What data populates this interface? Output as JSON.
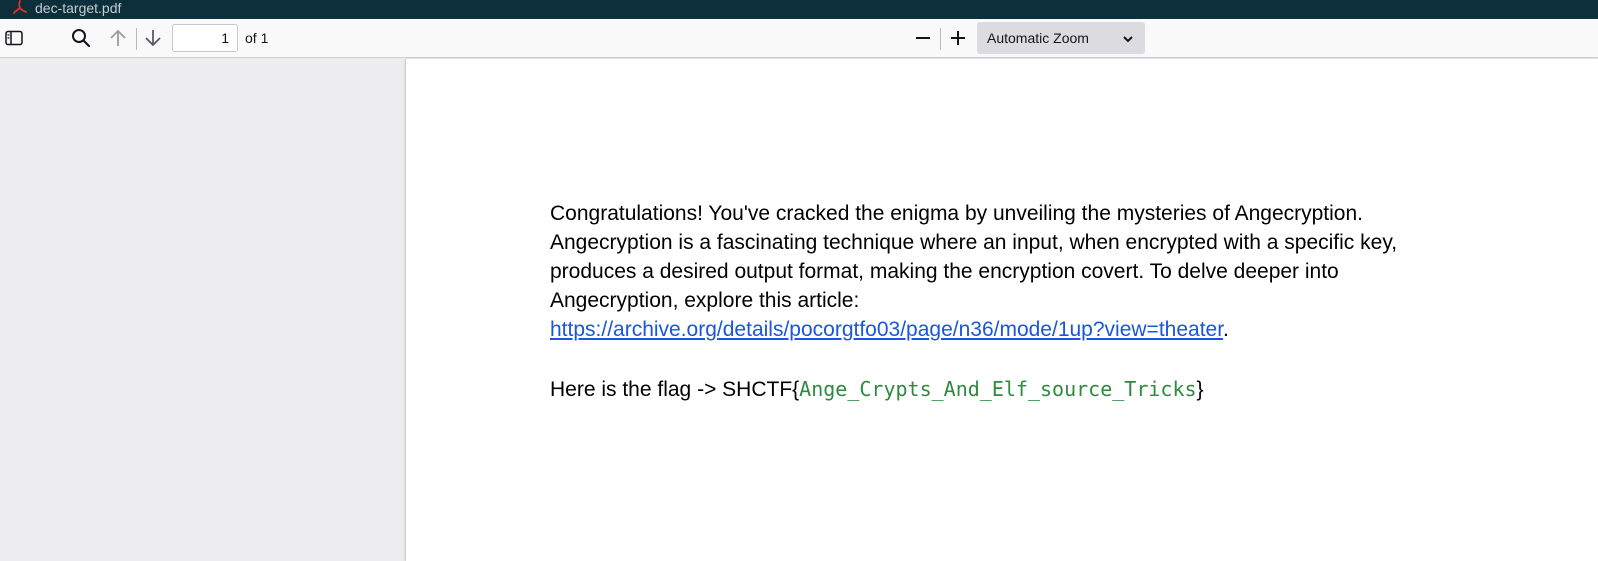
{
  "window": {
    "title": "dec-target.pdf"
  },
  "toolbar": {
    "page_number": "1",
    "page_count": "of 1",
    "zoom_selected": "Automatic Zoom",
    "icons": {
      "sidebar": "sidebar-toggle-icon",
      "search": "search-icon",
      "prev": "arrow-up-icon",
      "next": "arrow-down-icon",
      "zoom_out": "minus-icon",
      "zoom_in": "plus-icon",
      "dropdown": "chevron-down-icon"
    }
  },
  "document": {
    "paragraph": "Congratulations! You've cracked the enigma by unveiling the mysteries of Angecryption. Angecryption is a fascinating technique where an input, when encrypted with a specific key, produces a desired output format, making the encryption covert. To delve deeper into Angecryption, explore this article:",
    "link_text": "https://archive.org/details/pocorgtfo03/page/n36/mode/1up?view=theater",
    "link_suffix": ".",
    "flag_prefix": "Here is the flag -> SHCTF{",
    "flag_value": "Ange_Crypts_And_Elf_source_Tricks",
    "flag_suffix": "}"
  },
  "colors": {
    "titlebar_bg": "#0c2f3b",
    "toolbar_bg": "#f9f9fa",
    "viewer_bg": "#ededf0",
    "link": "#1a56db",
    "flag": "#2e8b3e",
    "pdf_icon": "#e5312a"
  }
}
